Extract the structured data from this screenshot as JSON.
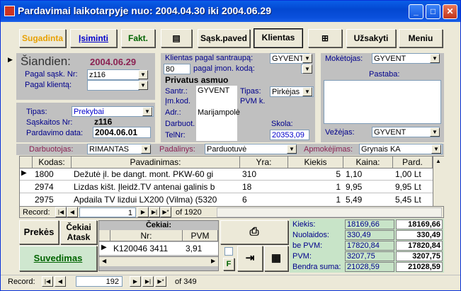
{
  "window": {
    "title": "Pardavimai laikotarpyje nuo: 2004.04.30 iki 2004.06.29"
  },
  "toolbar": {
    "sugadinta": "Sugadinta",
    "isiminti": "Įsiminti",
    "fakt": "Fakt.",
    "sask_paved": "Sąsk.paved",
    "klientas": "Klientas",
    "uzsakyti": "Užsakyti",
    "meniu": "Meniu"
  },
  "left": {
    "siandien_label": "Šiandien:",
    "siandien_value": "2004.06.29",
    "pagal_sask_label": "Pagal sąsk. Nr:",
    "pagal_sask_value": "z116",
    "pagal_kliento_label": "Pagal klientą:",
    "tipas_label": "Tipas:",
    "tipas_value": "Prekybai",
    "saskaitos_label": "Sąskaitos Nr:",
    "saskaitos_value": "z116",
    "data_label": "Pardavimo data:",
    "data_value": "2004.06.01"
  },
  "client": {
    "santrauka_label": "Klientas pagal santraupą:",
    "santrauka_value": "GYVENT",
    "kodas_num": "80",
    "kodas_label": "pagal įmon. kodą:",
    "name": "Privatus asmuo",
    "santr_label": "Santr.:",
    "santr_value": "GYVENT",
    "imkod_label": "Įm.kod.",
    "adr_label": "Adr.:",
    "adr_value": "Marijampolė",
    "darbuot_label": "Darbuot.",
    "telnr_label": "TelNr:",
    "tipas_label": "Tipas:",
    "tipas_value": "Pirkėjas",
    "pvm_label": "PVM k.",
    "skola_label": "Skola:",
    "skola_value": "20353,09"
  },
  "right": {
    "moketojas_label": "Mokėtojas:",
    "moketojas_value": "GYVENT",
    "pastaba_label": "Pastaba:",
    "vezejas_label": "Vežėjas:",
    "vezejas_value": "GYVENT"
  },
  "strip": {
    "darbuotojas_label": "Darbuotojas:",
    "darbuotojas_value": "RIMANTAS",
    "padalinys_label": "Padalinys:",
    "padalinys_value": "Parduotuvė",
    "apmokejimas_label": "Apmokėjimas:",
    "apmokejimas_value": "Grynais KA"
  },
  "grid": {
    "headers": [
      "Kodas:",
      "Pavadinimas:",
      "Yra:",
      "Kiekis",
      "Kaina:",
      "Pard."
    ],
    "rows": [
      [
        "1800",
        "Dežutė įl. be dangt. mont. PKW-60 gi",
        "310",
        "5",
        "1,10",
        "1,00 Lt"
      ],
      [
        "2974",
        "Lizdas kišt. Įleidž.TV antenai galinis b",
        "18",
        "1",
        "9,95",
        "9,95 Lt"
      ],
      [
        "2975",
        "Apdaila TV lizdui LX200 (Vilma) (5320",
        "6",
        "1",
        "5,49",
        "5,45 Lt"
      ]
    ],
    "record_label": "Record:",
    "record_current": "1",
    "record_of": "of  1920"
  },
  "bottom": {
    "prekes": "Prekės",
    "cekiai_atask": "Čekiai Atask",
    "suvedimas": "Suvedimas",
    "cekiai_title": "Čekiai:",
    "nr_header": "Nr:",
    "pvm_header": "PVM",
    "cek_nr": "K120046 3411",
    "cek_pvm": "3,91",
    "f_label": "F"
  },
  "summary": {
    "kiekis_label": "Kiekis:",
    "kiekis_v1": "18169,66",
    "kiekis_v2": "18169,66",
    "nuolaidos_label": "Nuolaidos:",
    "nuolaidos_v1": "330,49",
    "nuolaidos_v2": "330,49",
    "bepvm_label": "be PVM:",
    "bepvm_v1": "17820,84",
    "bepvm_v2": "17820,84",
    "pvm_label": "PVM:",
    "pvm_v1": "3207,75",
    "pvm_v2": "3207,75",
    "bendra_label": "Bendra suma:",
    "bendra_v1": "21028,59",
    "bendra_v2": "21028,59"
  },
  "footer": {
    "record_label": "Record:",
    "record_current": "192",
    "record_of": "of  349"
  }
}
